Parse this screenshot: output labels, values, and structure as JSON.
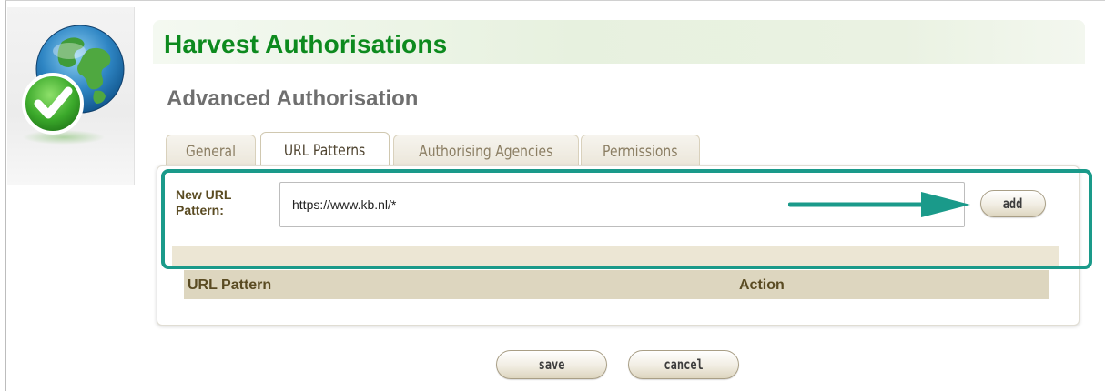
{
  "header": {
    "title": "Harvest Authorisations",
    "subtitle": "Advanced Authorisation"
  },
  "tabs": [
    {
      "label": "General",
      "active": false
    },
    {
      "label": "URL Patterns",
      "active": true
    },
    {
      "label": "Authorising Agencies",
      "active": false
    },
    {
      "label": "Permissions",
      "active": false
    }
  ],
  "form": {
    "new_url_label": "New URL Pattern:",
    "url_value": "https://www.kb.nl/*",
    "add_label": "add"
  },
  "table": {
    "columns": [
      "URL Pattern",
      "Action"
    ],
    "rows": []
  },
  "footer": {
    "save_label": "save",
    "cancel_label": "cancel"
  },
  "colors": {
    "title_green": "#0d8a1e",
    "highlight_teal": "#1a9a8a",
    "table_header_bg": "#ddd6bf"
  },
  "icons": {
    "logo": "globe-checkmark-icon",
    "annotation": "arrow-right-icon"
  }
}
